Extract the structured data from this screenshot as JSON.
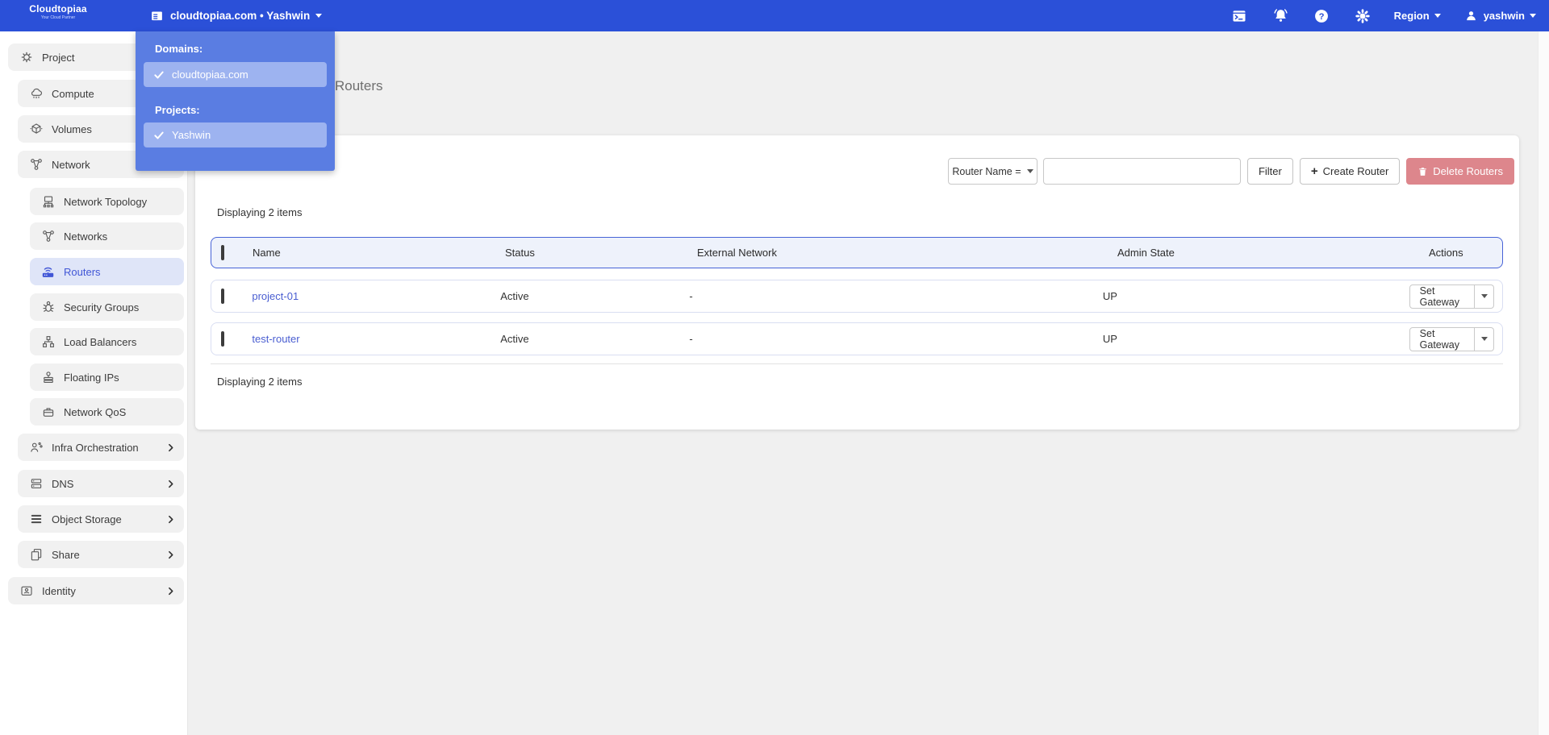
{
  "brand": {
    "name": "Cloudtopiaa",
    "tagline": "Your Cloud Partner"
  },
  "navbar": {
    "context_switcher": {
      "label": "cloudtopiaa.com • Yashwin"
    },
    "region_label": "Region",
    "user_label": "yashwin"
  },
  "context_dropdown": {
    "domains_label": "Domains:",
    "domains": [
      {
        "name": "cloudtopiaa.com",
        "selected": true
      }
    ],
    "projects_label": "Projects:",
    "projects": [
      {
        "name": "Yashwin",
        "selected": true
      }
    ]
  },
  "sidebar": {
    "items": [
      {
        "label": "Project"
      },
      {
        "label": "Compute"
      },
      {
        "label": "Volumes"
      },
      {
        "label": "Network"
      },
      {
        "label": "Network Topology"
      },
      {
        "label": "Networks"
      },
      {
        "label": "Routers",
        "active": true
      },
      {
        "label": "Security Groups"
      },
      {
        "label": "Load Balancers"
      },
      {
        "label": "Floating IPs"
      },
      {
        "label": "Network QoS"
      },
      {
        "label": "Infra Orchestration",
        "expandable": true
      },
      {
        "label": "DNS",
        "expandable": true
      },
      {
        "label": "Object Storage",
        "expandable": true
      },
      {
        "label": "Share",
        "expandable": true
      },
      {
        "label": "Identity",
        "expandable": true
      }
    ]
  },
  "page": {
    "title": "Routers"
  },
  "toolbar": {
    "filter_field_label": "Router Name =",
    "filter_input_value": "",
    "filter_button": "Filter",
    "create_button": "Create Router",
    "delete_button": "Delete Routers"
  },
  "table": {
    "count_top": "Displaying 2 items",
    "count_bottom": "Displaying 2 items",
    "columns": [
      "Name",
      "Status",
      "External Network",
      "Admin State",
      "Actions"
    ],
    "rows": [
      {
        "name": "project-01",
        "status": "Active",
        "external_network": "-",
        "admin_state": "UP",
        "action": "Set Gateway"
      },
      {
        "name": "test-router",
        "status": "Active",
        "external_network": "-",
        "admin_state": "UP",
        "action": "Set Gateway"
      }
    ]
  },
  "colors": {
    "navbar_blue": "#2b50d8",
    "dropdown_panel_blue": "#5a7de2",
    "dropdown_item_blue": "#9db3f0",
    "accent_blue": "#4156d6",
    "table_header_border": "#4763d7",
    "table_header_bg": "#eef2fb",
    "delete_red": "#dd868c",
    "link_blue": "#4a5ed1",
    "page_bg": "#f0f0f0"
  }
}
